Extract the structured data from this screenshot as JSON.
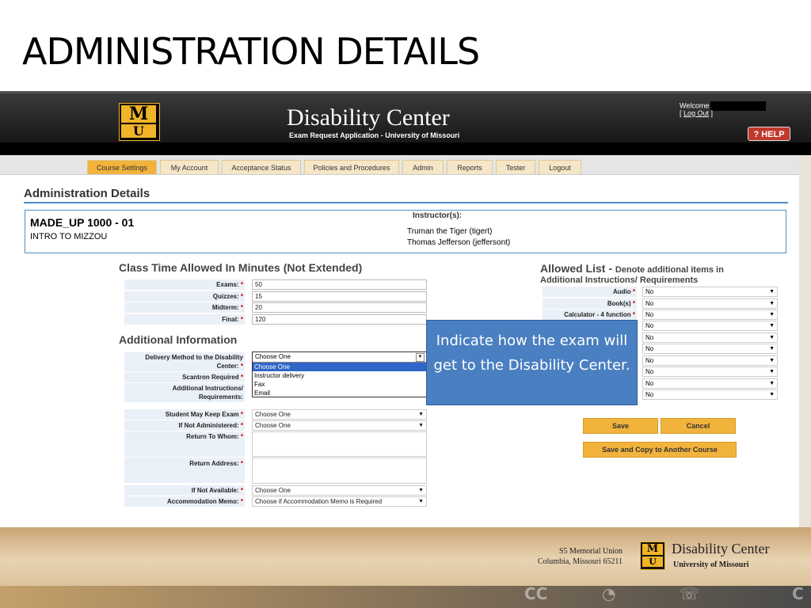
{
  "slide": {
    "title": "ADMINISTRATION DETAILS"
  },
  "app": {
    "logo_top": "M",
    "logo_bottom": "U",
    "title": "Disability Center",
    "subtitle": "Exam Request Application - University of Missouri",
    "welcome": "Welcome",
    "logout_pre": "[ ",
    "logout": "Log Out",
    "logout_post": " ]",
    "help": "? HELP"
  },
  "nav": {
    "tabs": [
      {
        "label": "Course Settings",
        "active": true
      },
      {
        "label": "My Account"
      },
      {
        "label": "Acceptance Status"
      },
      {
        "label": "Policies and Procedures"
      },
      {
        "label": "Admin"
      },
      {
        "label": "Reports"
      },
      {
        "label": "Tester"
      },
      {
        "label": "Logout"
      }
    ]
  },
  "page": {
    "heading": "Administration Details",
    "course_code": "MADE_UP 1000 - 01",
    "course_name": "INTRO TO MIZZOU",
    "instructors_label": "Instructor(s):",
    "instructors": [
      "Truman the Tiger (tigert)",
      "Thomas Jefferson (jeffersont)"
    ]
  },
  "class_time": {
    "heading": "Class Time Allowed In Minutes (Not Extended)",
    "fields": [
      {
        "label": "Exams:",
        "value": "50"
      },
      {
        "label": "Quizzes:",
        "value": "15"
      },
      {
        "label": "Midterm:",
        "value": "20"
      },
      {
        "label": "Final:",
        "value": "120"
      }
    ]
  },
  "additional": {
    "heading": "Additional Information",
    "delivery_label_1": "Delivery Method to the Disability",
    "delivery_label_2": "Center:",
    "delivery_value": "Choose One",
    "delivery_options": [
      "Choose One",
      "Instructor delivery",
      "Fax",
      "Email"
    ],
    "scantron_label": "Scantron Required",
    "addl_instr_label_1": "Additional Instructions/",
    "addl_instr_label_2": "Requirements:",
    "keep_exam_label": "Student May Keep Exam",
    "keep_exam_value": "Choose One",
    "not_admin_label": "If Not Administered:",
    "not_admin_value": "Choose One",
    "return_whom_label": "Return To Whom:",
    "return_addr_label": "Return Address:",
    "not_avail_label": "If Not Available:",
    "not_avail_value": "Choose One",
    "memo_label": "Accommodation Memo:",
    "memo_value": "Choose if Accommodation Memo is Required"
  },
  "allowed": {
    "heading_main": "Allowed List - ",
    "heading_note": "Denote additional items in",
    "heading_line2": "Additional Instructions/ Requirements",
    "items": [
      {
        "label": "Audio",
        "value": "No",
        "required": true
      },
      {
        "label": "Book(s)",
        "value": "No",
        "required": true
      },
      {
        "label": "Calculator - 4 function",
        "value": "No",
        "required": true
      },
      {
        "label": "",
        "value": "No"
      },
      {
        "label": "",
        "value": "No"
      },
      {
        "label": "",
        "value": "No"
      },
      {
        "label": "",
        "value": "No"
      },
      {
        "label": "",
        "value": "No"
      },
      {
        "label": "",
        "value": "No"
      }
    ]
  },
  "buttons": {
    "save": "Save",
    "cancel": "Cancel",
    "save_copy": "Save and Copy to Another Course"
  },
  "callout": {
    "text": "Indicate how the exam will get to the Disability Center."
  },
  "footer": {
    "address_line1": "S5 Memorial Union",
    "address_line2": "Columbia, Missouri 65211",
    "logo_top": "M",
    "logo_bottom": "U",
    "brand": "Disability Center",
    "brand_sub": "University of Missouri"
  },
  "colors": {
    "accent_blue": "#4d8ec4",
    "tab_gold": "#f2b33d",
    "callout_blue": "#4a7fc1",
    "required_red": "#cc0000"
  }
}
